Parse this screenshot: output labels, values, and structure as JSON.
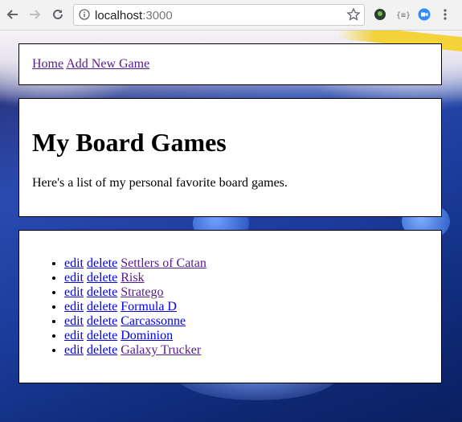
{
  "browser": {
    "url_host": "localhost",
    "url_port": ":3000"
  },
  "nav": {
    "home_label": "Home",
    "add_label": "Add New Game"
  },
  "header": {
    "title": "My Board Games",
    "intro": "Here's a list of my personal favorite board games."
  },
  "games": {
    "edit_label": "edit",
    "delete_label": "delete",
    "items": [
      {
        "name": "Settlers of Catan"
      },
      {
        "name": "Risk"
      },
      {
        "name": "Stratego"
      },
      {
        "name": "Formula D"
      },
      {
        "name": "Carcassonne"
      },
      {
        "name": "Dominion"
      },
      {
        "name": "Galaxy Trucker"
      }
    ]
  },
  "colors": {
    "link": "#0000ee",
    "visited_link": "#551a8b"
  },
  "icons": [
    "back-icon",
    "forward-icon",
    "reload-icon",
    "info-icon",
    "star-icon",
    "extension-icon",
    "menu-icon"
  ]
}
